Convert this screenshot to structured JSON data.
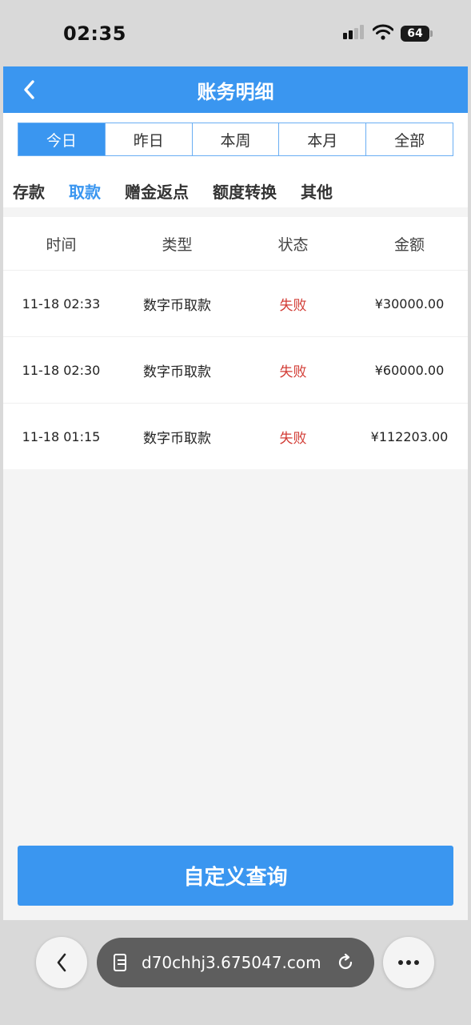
{
  "status_bar": {
    "time": "02:35",
    "battery": "64"
  },
  "nav": {
    "title": "账务明细"
  },
  "date_tabs": [
    {
      "label": "今日",
      "active": true
    },
    {
      "label": "昨日",
      "active": false
    },
    {
      "label": "本周",
      "active": false
    },
    {
      "label": "本月",
      "active": false
    },
    {
      "label": "全部",
      "active": false
    }
  ],
  "type_tabs": [
    {
      "label": "存款",
      "active": false
    },
    {
      "label": "取款",
      "active": true
    },
    {
      "label": "赠金返点",
      "active": false
    },
    {
      "label": "额度转换",
      "active": false
    },
    {
      "label": "其他",
      "active": false
    }
  ],
  "table": {
    "headers": [
      "时间",
      "类型",
      "状态",
      "金额"
    ],
    "rows": [
      {
        "time": "11-18 02:33",
        "type": "数字币取款",
        "status": "失败",
        "amount": "¥30000.00"
      },
      {
        "time": "11-18 02:30",
        "type": "数字币取款",
        "status": "失败",
        "amount": "¥60000.00"
      },
      {
        "time": "11-18 01:15",
        "type": "数字币取款",
        "status": "失败",
        "amount": "¥112203.00"
      }
    ]
  },
  "query_button": {
    "label": "自定义查询"
  },
  "browser": {
    "url": "d70chhj3.675047.com"
  },
  "colors": {
    "accent": "#3a96f0",
    "status_failed": "#d23b34"
  }
}
